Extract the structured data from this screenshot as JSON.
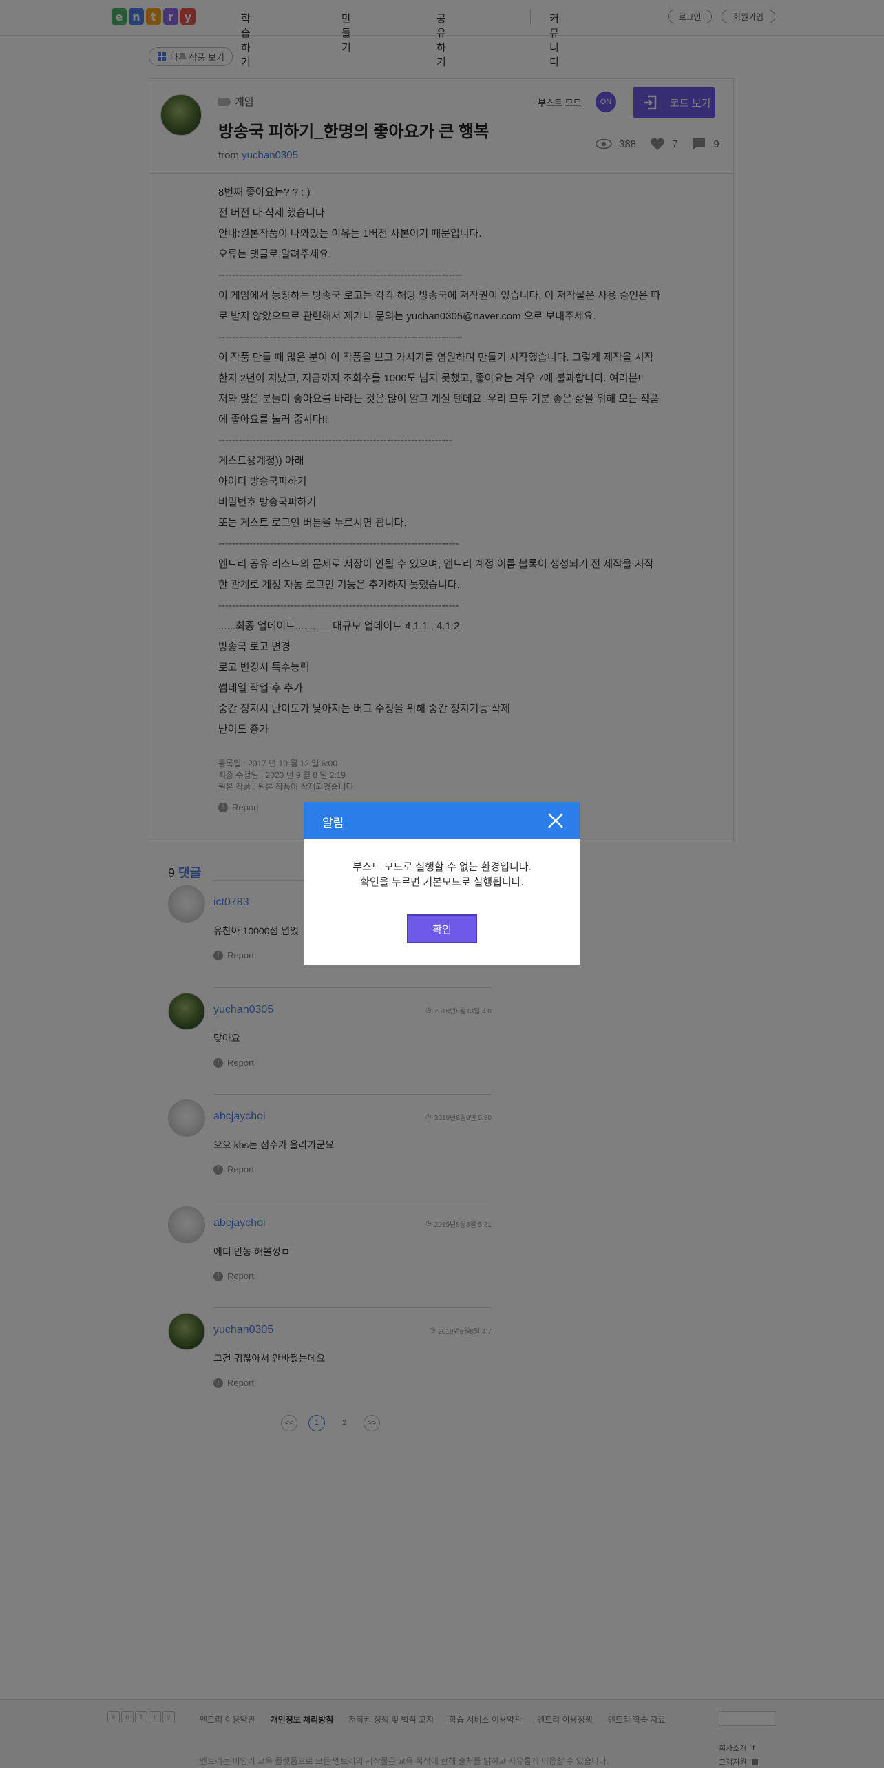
{
  "header": {
    "logo_letters": [
      "e",
      "n",
      "t",
      "r",
      "y"
    ],
    "logo_colors": [
      "#4db36b",
      "#4f80e1",
      "#f5a623",
      "#8e6ae6",
      "#e8554e"
    ],
    "nav": [
      "학습하기",
      "만들기",
      "공유하기",
      "커뮤니티"
    ],
    "login": "로그인",
    "signup": "회원가입"
  },
  "other_works_label": "다른 작품 보기",
  "project": {
    "category": "게임",
    "title": "방송국 피하기_한명의 좋아요가 큰 행복",
    "from_label": "from",
    "author": "yuchan0305",
    "boost_label": "부스트 모드",
    "boost_state": "ON",
    "code_button": "코드 보기",
    "views": "388",
    "likes": "7",
    "comments": "9",
    "description": [
      "8번째 좋아요는? ? : )",
      "전 버전 다 삭제 했습니다",
      "안내:원본작품이 나와있는 이유는 1버전 사본이기 때문입니다.",
      "오류는 댓글로 알려주세요.",
      "-----------------------------------------------------------------------",
      "이 게임에서 등장하는 방송국 로고는 각각 해당 방송국에 저작권이 있습니다. 이 저작물은 사용 승인은 따",
      "로 받지 않았으므로 관련해서 제거나 문의는 yuchan0305@naver.com 으로 보내주세요.",
      "-----------------------------------------------------------------------",
      "이 작품 만들 때 많은 분이 이 작품을 보고 가시기를 염원하며 만들기 시작했습니다. 그렇게 제작을 시작",
      "한지 2년이 지났고, 지금까지 조회수를 1000도 넘지 못했고, 좋아요는 겨우 7에 불과합니다. 여러분!!",
      "저와 많은 분들이 좋아요를 바라는 것은 많이 알고 계실 텐데요. 우리 모두 기분 좋은 삶을 위해 모든 작품",
      "에 좋아요를 눌러 줍시다!!",
      "--------------------------------------------------------------------",
      "게스트용계정)) 아래",
      "아이디 방송국피하기",
      "비밀번호 방송국피하기",
      "또는 게스트 로그인 버튼을 누르시면 됩니다.",
      "----------------------------------------------------------------------",
      "엔트리 공유 리스트의 문제로 저장이 안될 수 있으며, 엔트리 계정 이름 블록이 생성되기 전 제작을 시작",
      "한 관계로 계정 자동 로그인 기능은 추가하지 못했습니다.",
      "----------------------------------------------------------------------",
      "......최종 업데이트.......___대규모 업데이트 4.1.1 , 4.1.2",
      "방송국 로고 변경",
      "로고 변경시 특수능력",
      "썸네일 작업 후 추가",
      "중간 정지시 난이도가 낮아지는 버그 수정을 위해 중간 정지기능 삭제",
      "난이도 증가"
    ],
    "meta": [
      "등록일 : 2017 년 10 월 12 일 6:00",
      "최종 수정일 : 2020 년 9 월 8 일 2:19",
      "원본 작품 : 원본 작품이 삭제되었습니다"
    ],
    "report_label": "Report"
  },
  "comments": {
    "count": "9",
    "label": "댓글",
    "items": [
      {
        "user": "ict0783",
        "date": "",
        "text": "유찬아 10000점 넘었",
        "avatar": "default"
      },
      {
        "user": "yuchan0305",
        "date": "2019년8월13일 4:0",
        "text": "맞아요",
        "avatar": "photo"
      },
      {
        "user": "abcjaychoi",
        "date": "2019년8월9일 5:30",
        "text": "오오 kbs는 점수가 올라가군요",
        "avatar": "default"
      },
      {
        "user": "abcjaychoi",
        "date": "2019년8월8일 5:31",
        "text": "에디 안농 해볼껑ㅁ",
        "avatar": "default"
      },
      {
        "user": "yuchan0305",
        "date": "2019년8월8일 4:7",
        "text": "그건 귀찮아서 안바꿨는데요",
        "avatar": "photo"
      }
    ],
    "report_label": "Report"
  },
  "pager": {
    "prev": "<<",
    "current": "1",
    "next_page": "2",
    "next": ">>"
  },
  "footer": {
    "links": [
      "엔트리 이용약관",
      "개인정보 처리방침",
      "저작권 정책 및 법적 고지",
      "학습 서비스 이용약관",
      "엔트리 이용정책",
      "엔트리 학습 자료"
    ],
    "side": [
      "회사소개",
      "고객지원"
    ],
    "copy": "엔트리는 비영리 교육 플랫폼으로 모든 엔트리의 저작물은 교육 목적에 한해 출처를 밝히고 자유롭게 이용할 수 있습니다."
  },
  "modal": {
    "title": "알림",
    "line1": "부스트 모드로 실행할 수 없는 환경입니다.",
    "line2": "확인을 누르면 기본모드로 실행됩니다.",
    "ok": "확인"
  }
}
